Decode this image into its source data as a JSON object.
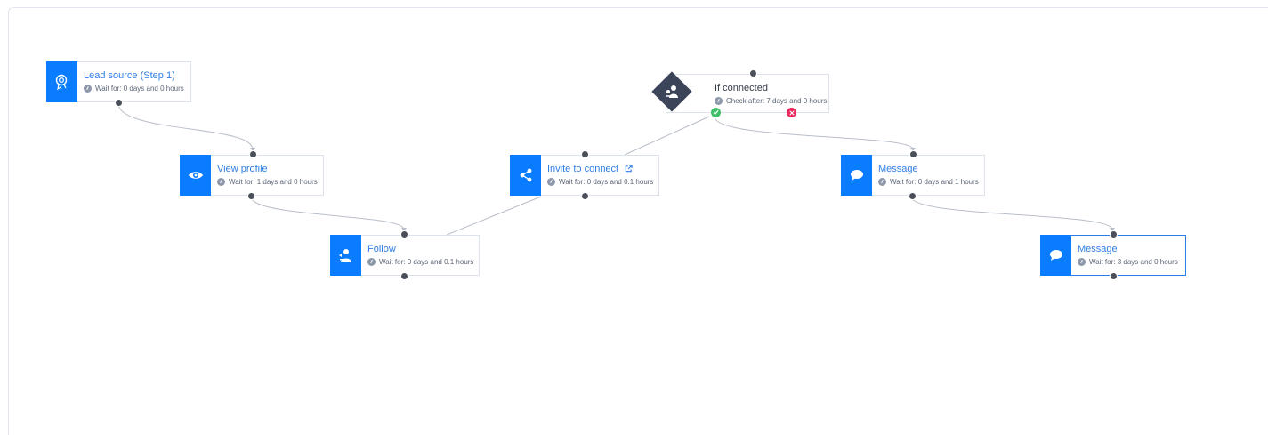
{
  "colors": {
    "accent": "#0a7cff",
    "title_blue": "#2f7ee6",
    "condition_dark": "#3b4459",
    "yes_green": "#3ec06a",
    "no_red": "#e8285c",
    "edge": "#b8bec8"
  },
  "nodes": {
    "lead_source": {
      "title": "Lead source (Step 1)",
      "sub": "Wait for: 0 days and 0 hours",
      "icon": "badge-icon"
    },
    "view_profile": {
      "title": "View profile",
      "sub": "Wait for: 1 days and 0 hours",
      "icon": "eye-icon"
    },
    "follow": {
      "title": "Follow",
      "sub": "Wait for: 0 days and 0.1 hours",
      "icon": "follow-icon"
    },
    "invite": {
      "title": "Invite to connect",
      "sub": "Wait for: 0 days and 0.1 hours",
      "icon": "share-icon"
    },
    "if_connected": {
      "title": "If connected",
      "sub": "Check after: 7 days and 0 hours",
      "icon": "connected-icon"
    },
    "message1": {
      "title": "Message",
      "sub": "Wait for: 0 days and 1 hours",
      "icon": "chat-bubble-icon"
    },
    "message2": {
      "title": "Message",
      "sub": "Wait for: 3 days and 0 hours",
      "icon": "chat-bubble-icon"
    }
  }
}
